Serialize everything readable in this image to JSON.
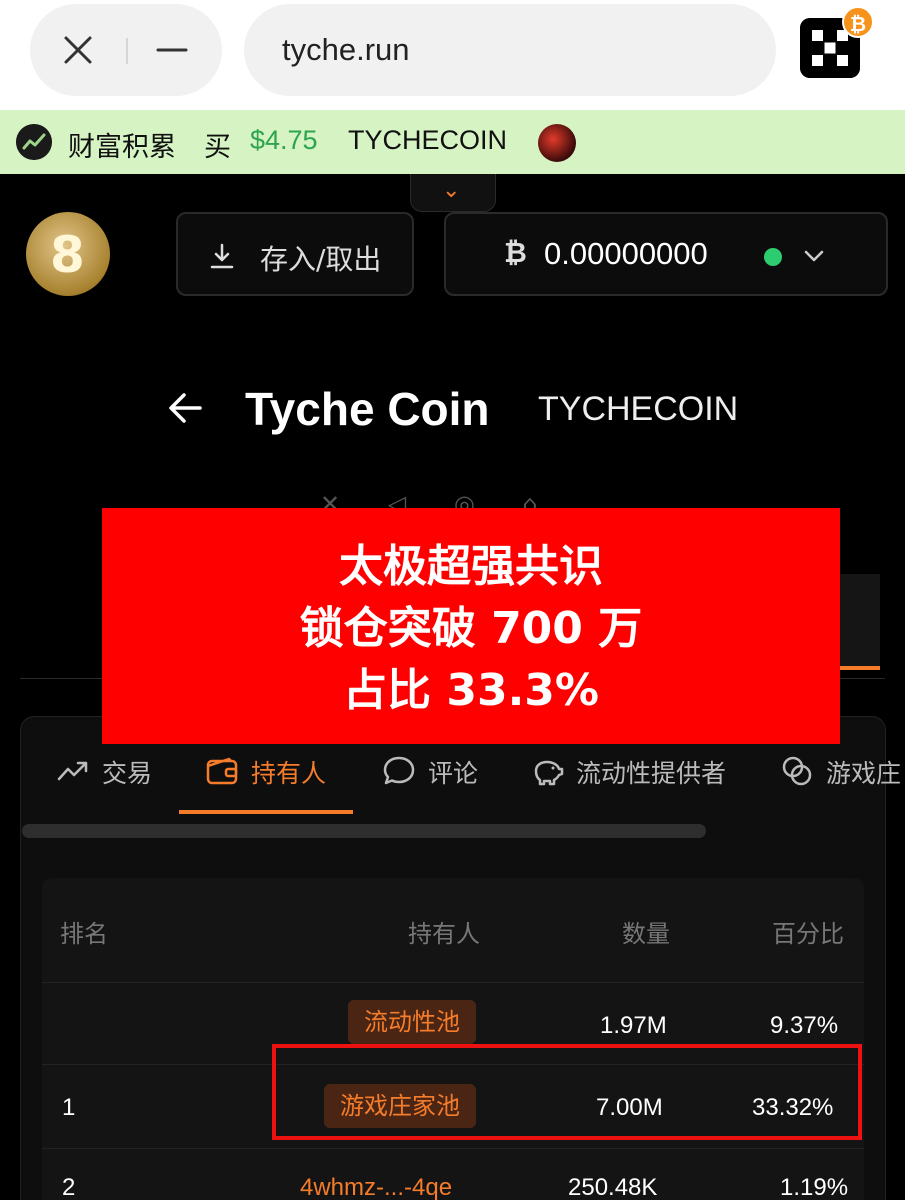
{
  "browser": {
    "url": "tyche.run",
    "badge": "₿"
  },
  "ticker": {
    "label": "财富积累",
    "action": "买",
    "price": "$4.75",
    "symbol": "TYCHECOIN"
  },
  "header": {
    "logo_glyph": "8",
    "deposit_label": "存入/取出",
    "btc_symbol": "₿",
    "balance": "0.00000000",
    "status_color": "#2ecc71"
  },
  "token": {
    "name": "Tyche Coin",
    "symbol": "TYCHECOIN"
  },
  "banner": {
    "line1": "太极超强共识",
    "line2": "锁仓突破 700 万",
    "line3": "占比 33.3%"
  },
  "tabs": [
    {
      "label": "交易",
      "icon": "trending-up-icon"
    },
    {
      "label": "持有人",
      "icon": "wallet-icon"
    },
    {
      "label": "评论",
      "icon": "comment-icon"
    },
    {
      "label": "流动性提供者",
      "icon": "piggy-bank-icon"
    },
    {
      "label": "游戏庄",
      "icon": "coins-icon"
    }
  ],
  "table": {
    "headers": {
      "rank": "排名",
      "holder": "持有人",
      "amount": "数量",
      "percent": "百分比"
    },
    "rows": [
      {
        "rank": "",
        "holder": "流动性池",
        "amount": "1.97M",
        "percent": "9.37%"
      },
      {
        "rank": "1",
        "holder": "游戏庄家池",
        "amount": "7.00M",
        "percent": "33.32%"
      },
      {
        "rank": "2",
        "holder": "4whmz-...-4qe",
        "amount": "250.48K",
        "percent": "1.19%"
      }
    ]
  },
  "colors": {
    "accent": "#f57c2a",
    "ticker_bg": "#d6f3c4",
    "price_green": "#2ea44f",
    "banner_red": "#ff0000"
  }
}
